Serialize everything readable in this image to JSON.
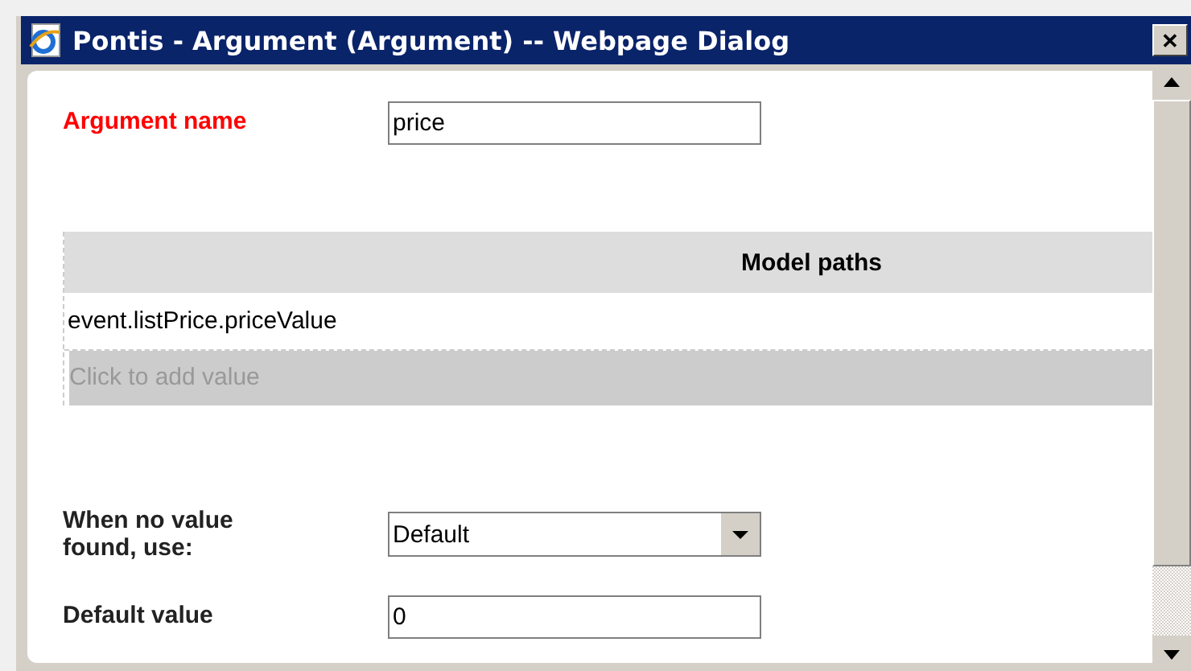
{
  "window": {
    "title": "Pontis - Argument (Argument) -- Webpage Dialog",
    "close": "✕"
  },
  "argument_name": {
    "label": "Argument name",
    "value": "price",
    "required": true
  },
  "table": {
    "columns": [
      "Model paths"
    ],
    "rows": [
      "event.listPrice.priceValue"
    ],
    "add_row": "Click to add value"
  },
  "fallback": {
    "label": "When no value found, use:",
    "value": "Default"
  },
  "default_value": {
    "label": "Default value",
    "value": "0"
  }
}
